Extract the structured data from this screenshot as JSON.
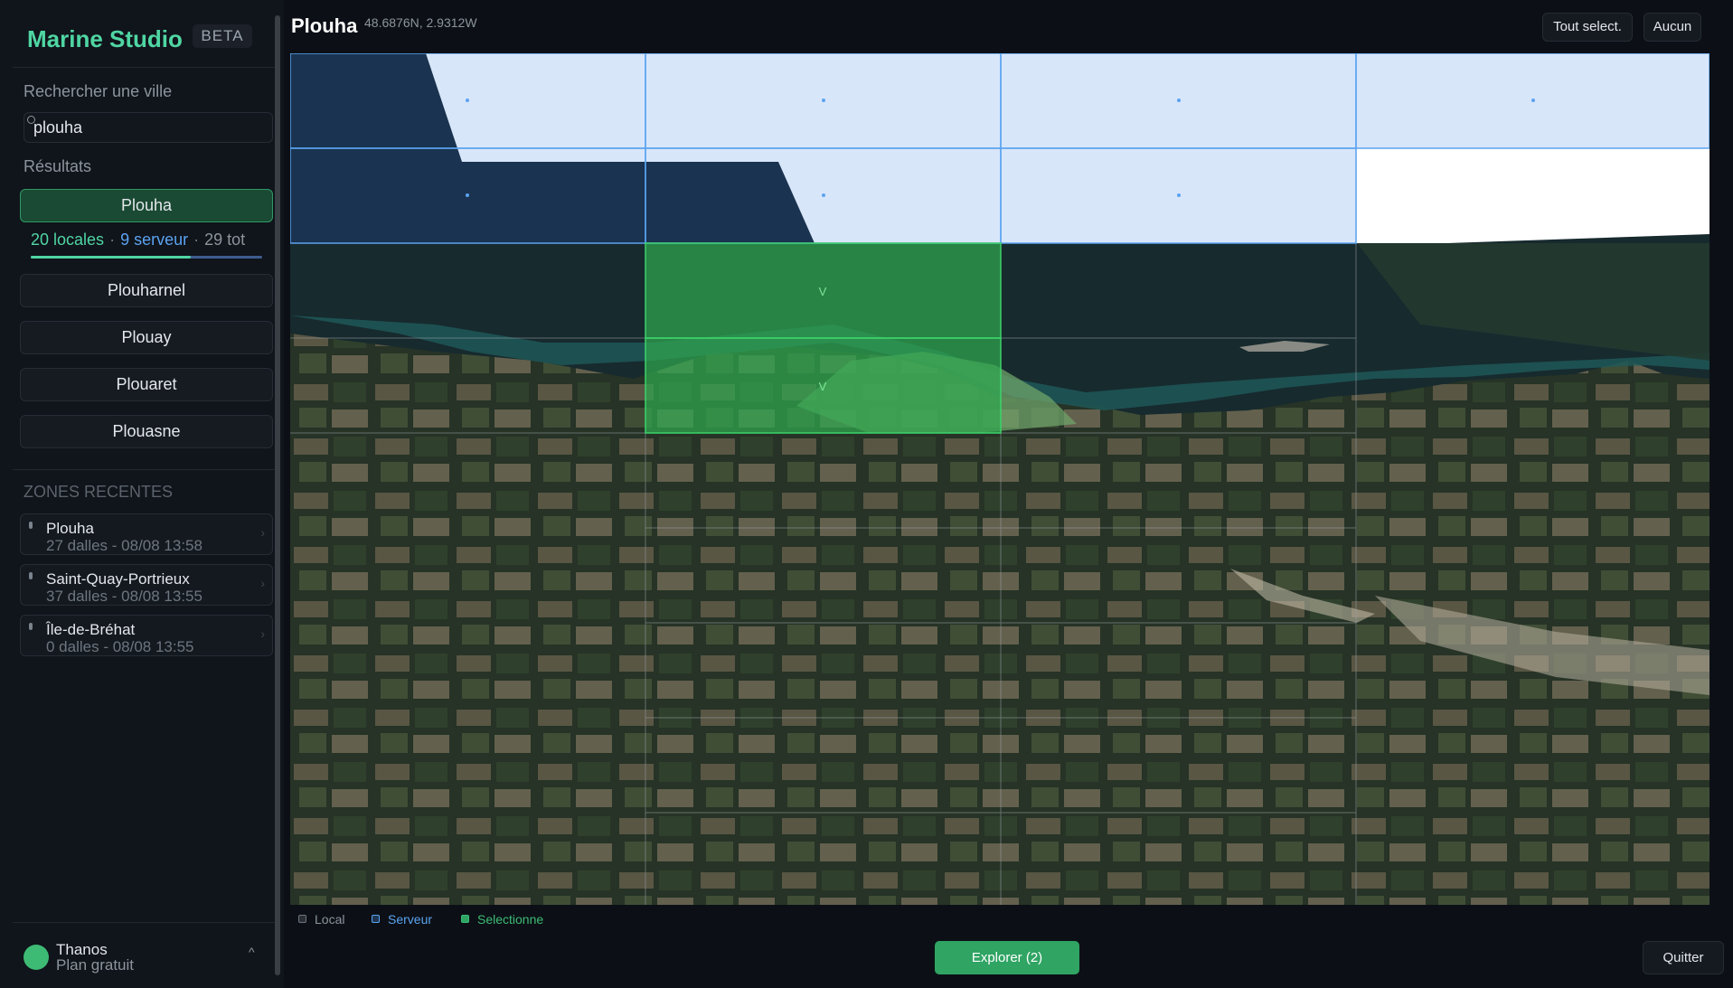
{
  "app": {
    "name": "Marine Studio",
    "badge": "BETA"
  },
  "search": {
    "label": "Rechercher une ville",
    "value": "plouha"
  },
  "results": {
    "label": "Résultats",
    "selected": "Plouha",
    "stats": {
      "local": "20 locales",
      "server": "9 serveur",
      "total": "29 tot"
    },
    "local_fraction": 0.69,
    "items": [
      "Plouharnel",
      "Plouay",
      "Plouaret",
      "Plouasne"
    ]
  },
  "recent": {
    "label": "ZONES RECENTES",
    "items": [
      {
        "name": "Plouha",
        "sub": "27 dalles - 08/08 13:58"
      },
      {
        "name": "Saint-Quay-Portrieux",
        "sub": "37 dalles - 08/08 13:55"
      },
      {
        "name": "Île-de-Bréhat",
        "sub": "0 dalles - 08/08 13:55"
      }
    ]
  },
  "user": {
    "name": "Thanos",
    "plan": "Plan gratuit",
    "caret": "^"
  },
  "header": {
    "title": "Plouha",
    "coords": "48.6876N, 2.9312W",
    "select_all": "Tout select.",
    "select_none": "Aucun"
  },
  "grid": {
    "cols": 4,
    "rows": 9,
    "server_tiles": [
      [
        0,
        0
      ],
      [
        0,
        1
      ],
      [
        0,
        2
      ],
      [
        0,
        3
      ],
      [
        1,
        0
      ],
      [
        1,
        1
      ],
      [
        1,
        2
      ]
    ],
    "selected_tiles": [
      [
        2,
        1
      ],
      [
        3,
        1
      ]
    ],
    "selected_mark": "V"
  },
  "legend": {
    "local": "Local",
    "server": "Serveur",
    "selected": "Selectionne"
  },
  "colors": {
    "accent": "#4fd6a3",
    "server": "#5ba3f0",
    "selected": "#3dbb74"
  },
  "footer": {
    "explore": "Explorer (2)",
    "quit": "Quitter"
  }
}
